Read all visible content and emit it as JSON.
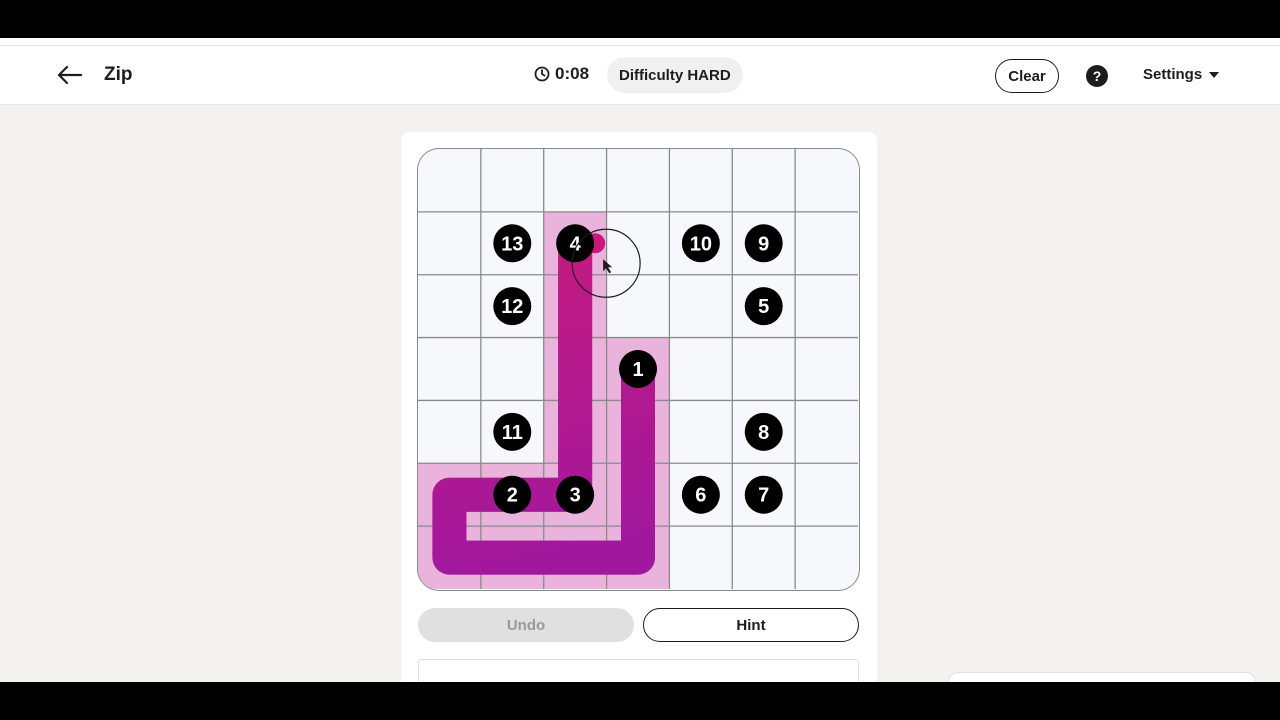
{
  "header": {
    "title": "Zip",
    "timer": "0:08",
    "difficulty": "Difficulty HARD",
    "clear_label": "Clear",
    "help_label": "?",
    "settings_label": "Settings"
  },
  "icons": {
    "back": "arrow-left-icon",
    "timer": "clock-icon",
    "help": "question-icon",
    "settings": "chevron-down-icon"
  },
  "board": {
    "rows": 7,
    "cols": 7,
    "numbers": [
      {
        "label": "13",
        "row": 1,
        "col": 1
      },
      {
        "label": "4",
        "row": 1,
        "col": 2
      },
      {
        "label": "10",
        "row": 1,
        "col": 4
      },
      {
        "label": "9",
        "row": 1,
        "col": 5
      },
      {
        "label": "12",
        "row": 2,
        "col": 1
      },
      {
        "label": "5",
        "row": 2,
        "col": 5
      },
      {
        "label": "1",
        "row": 3,
        "col": 3
      },
      {
        "label": "11",
        "row": 4,
        "col": 1
      },
      {
        "label": "8",
        "row": 4,
        "col": 5
      },
      {
        "label": "2",
        "row": 5,
        "col": 1
      },
      {
        "label": "3",
        "row": 5,
        "col": 2
      },
      {
        "label": "6",
        "row": 5,
        "col": 4
      },
      {
        "label": "7",
        "row": 5,
        "col": 5
      }
    ],
    "path": [
      {
        "row": 3,
        "col": 3
      },
      {
        "row": 4,
        "col": 3
      },
      {
        "row": 5,
        "col": 3
      },
      {
        "row": 6,
        "col": 3
      },
      {
        "row": 6,
        "col": 2
      },
      {
        "row": 6,
        "col": 1
      },
      {
        "row": 6,
        "col": 0
      },
      {
        "row": 5,
        "col": 0
      },
      {
        "row": 5,
        "col": 1
      },
      {
        "row": 5,
        "col": 2
      },
      {
        "row": 4,
        "col": 2
      },
      {
        "row": 3,
        "col": 2
      },
      {
        "row": 2,
        "col": 2
      },
      {
        "row": 1,
        "col": 2
      }
    ],
    "colors": {
      "path_start": "#a0189e",
      "path_end": "#c81a7c",
      "visited_cell": "#e9b3dc",
      "grid_line": "#8a8a8a",
      "cell_bg": "#f7f8fc",
      "number_bg": "#000000"
    }
  },
  "actions": {
    "undo_label": "Undo",
    "hint_label": "Hint"
  }
}
